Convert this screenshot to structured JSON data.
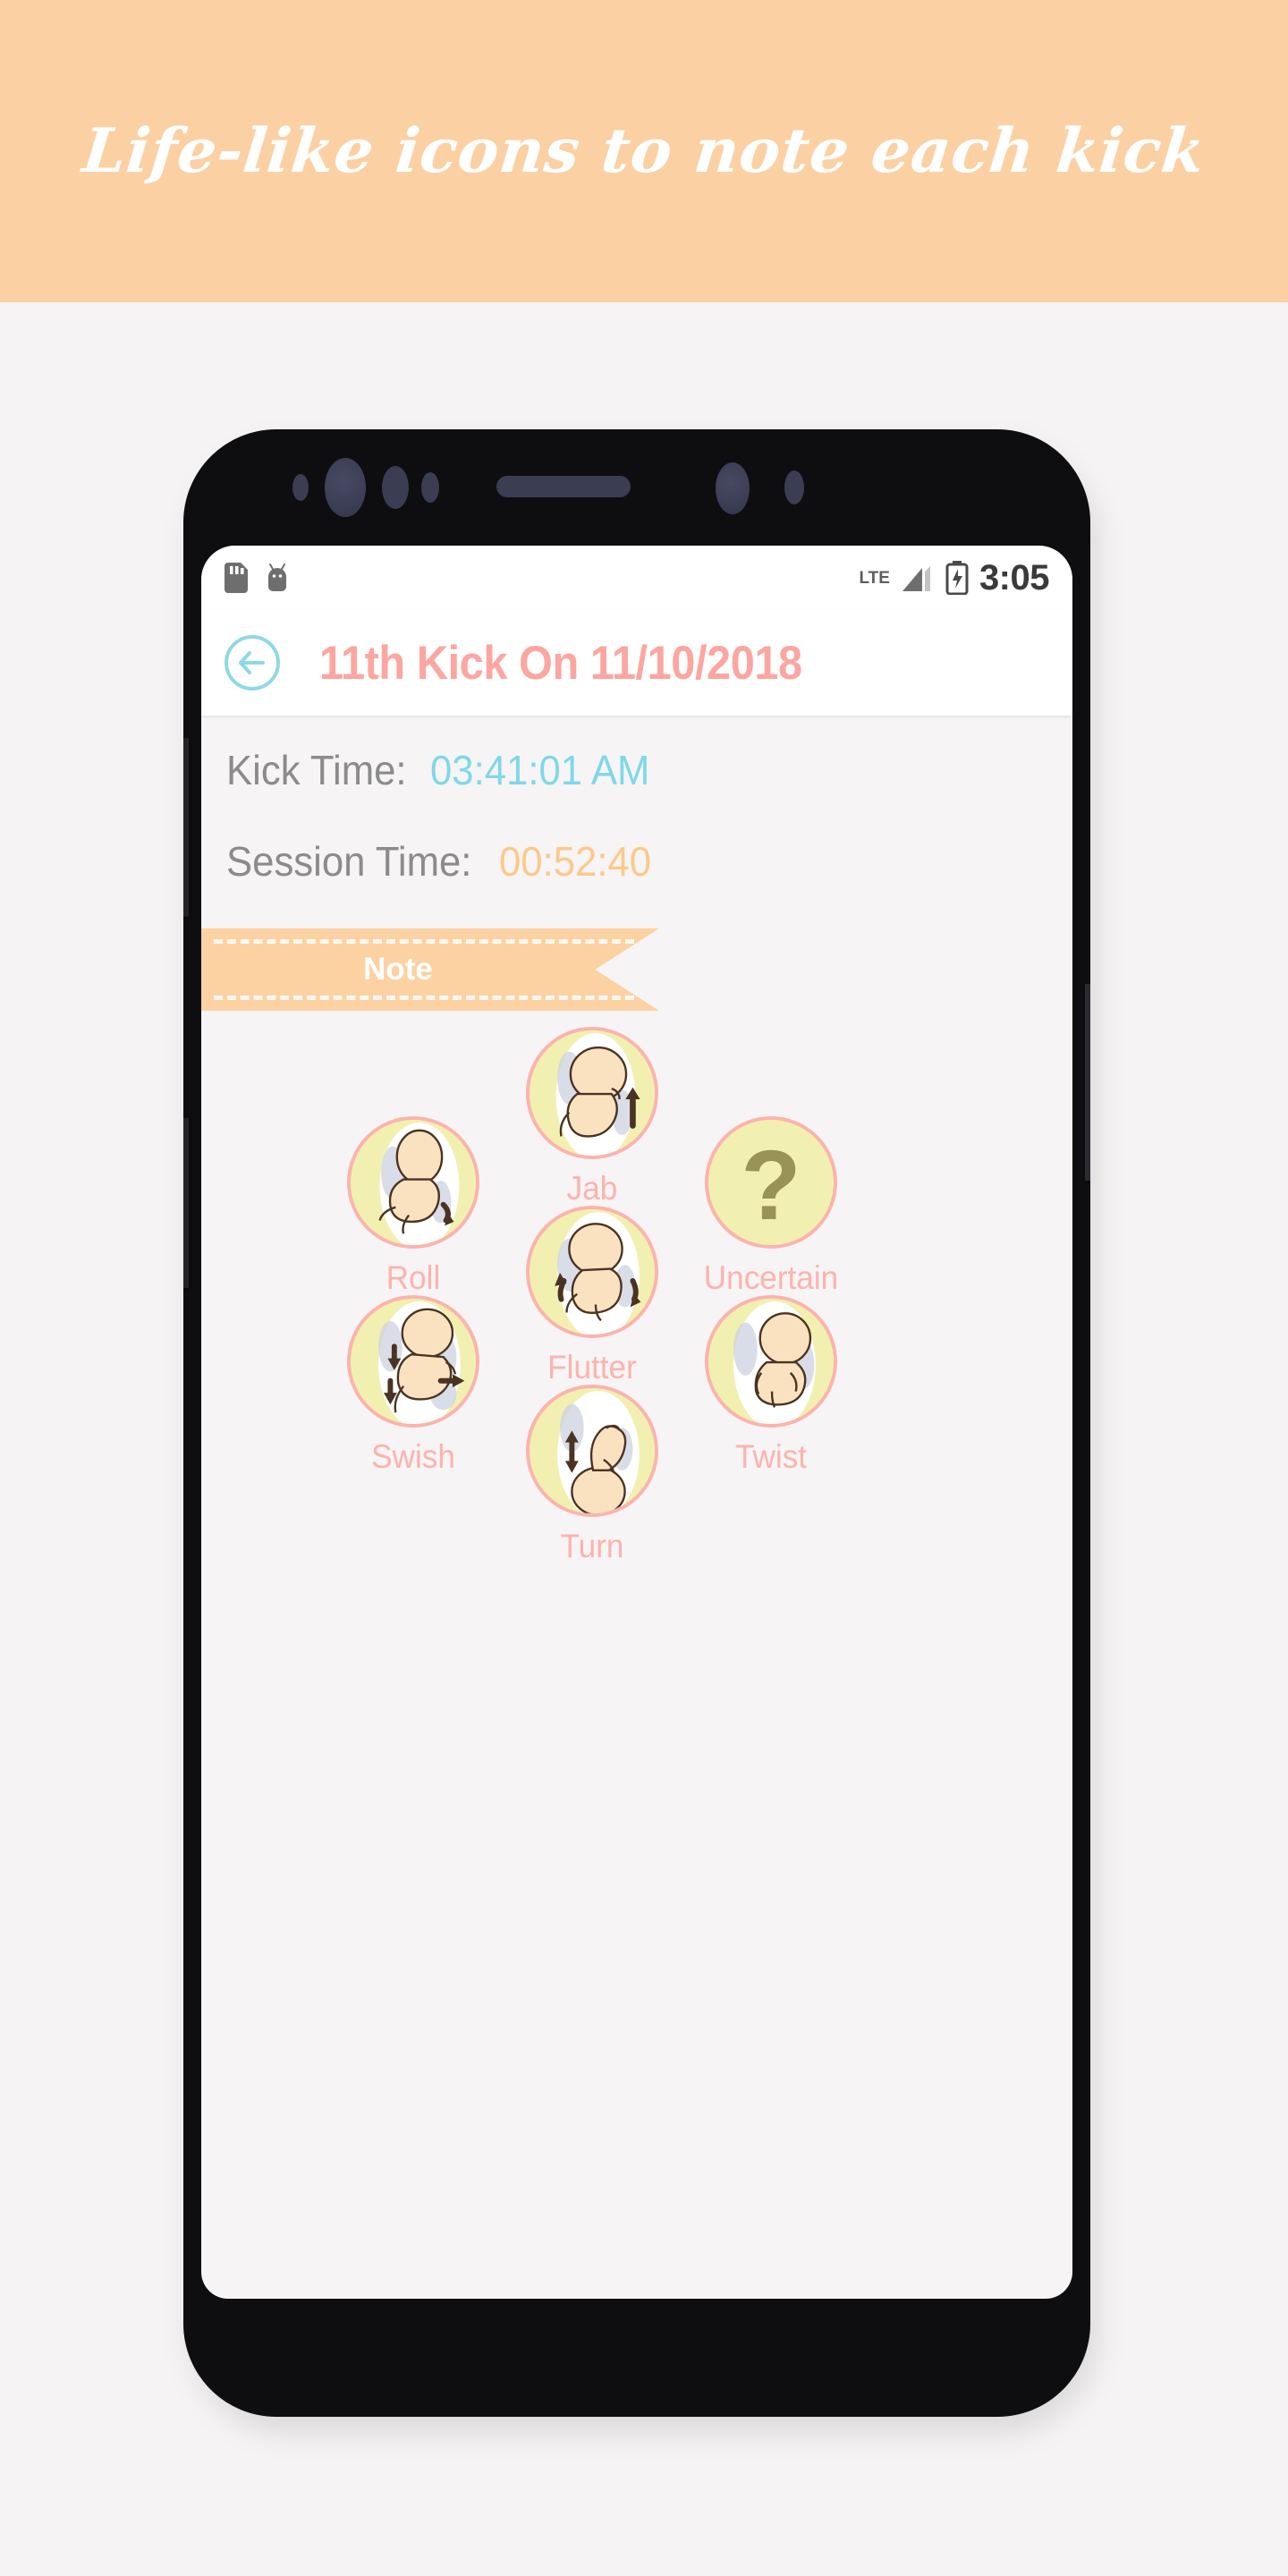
{
  "promo": {
    "tagline": "Life-like icons to note each kick",
    "background_color": "#fbd0a3",
    "text_color": "#ffffff"
  },
  "page_background": "#f5f3f3",
  "device": {
    "frame_color": "#0e0e10",
    "buttons": [
      {
        "name": "volume-up",
        "side": "left"
      },
      {
        "name": "volume-down",
        "side": "left"
      },
      {
        "name": "power",
        "side": "right"
      }
    ]
  },
  "status_bar": {
    "left_icons": [
      "sd-card-icon",
      "android-robot-icon"
    ],
    "network": "LTE",
    "signal_icon": "signal-bars-icon",
    "battery_icon": "battery-charging-icon",
    "time": "3:05"
  },
  "app_bar": {
    "back_icon": "back-arrow-icon",
    "back_icon_color": "#8fd9e3",
    "title": "11th Kick On 11/10/2018",
    "title_color": "#fca6a1"
  },
  "details": {
    "rows": [
      {
        "label": "Kick Time:",
        "value": "03:41:01 AM",
        "value_color": "#7fd8e8"
      },
      {
        "label": "Session Time:",
        "value": "00:52:40",
        "value_color": "#fcc98a"
      }
    ]
  },
  "note_ribbon": {
    "label": "Note",
    "background_color": "#fcd2a3",
    "text_color": "#ffffff"
  },
  "kick_types": {
    "label_color": "#fcb3ae",
    "ring_color": "#fcb3ae",
    "fill_color": "#f1f0b0",
    "items": [
      {
        "id": "jab",
        "label": "Jab",
        "icon": "fetus-jab-icon"
      },
      {
        "id": "roll",
        "label": "Roll",
        "icon": "fetus-roll-icon"
      },
      {
        "id": "uncertain",
        "label": "Uncertain",
        "icon": "question-mark-icon"
      },
      {
        "id": "flutter",
        "label": "Flutter",
        "icon": "fetus-flutter-icon"
      },
      {
        "id": "swish",
        "label": "Swish",
        "icon": "fetus-swish-icon"
      },
      {
        "id": "twist",
        "label": "Twist",
        "icon": "fetus-twist-icon"
      },
      {
        "id": "turn",
        "label": "Turn",
        "icon": "fetus-turn-icon"
      }
    ],
    "uncertain_glyph": "?"
  }
}
